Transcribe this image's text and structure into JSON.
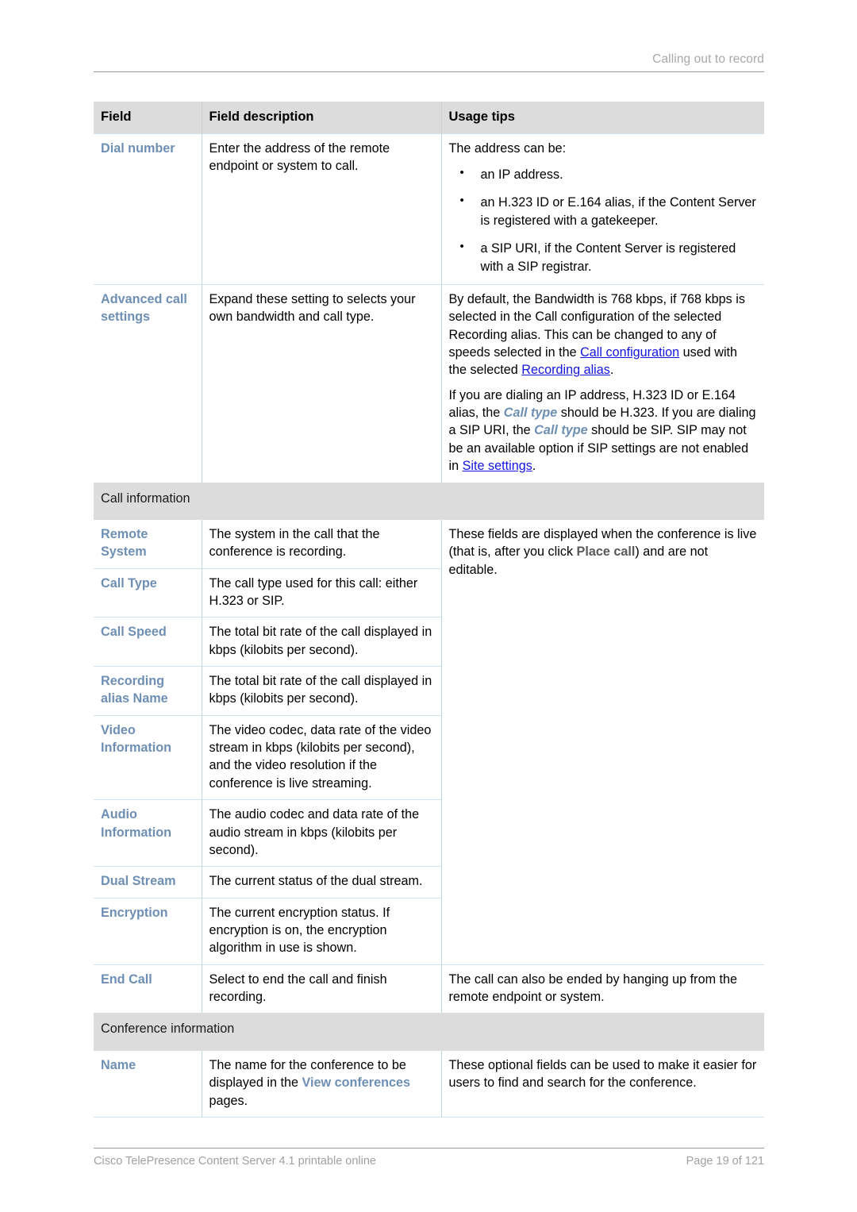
{
  "header": {
    "running_title": "Calling out to record"
  },
  "table": {
    "columns": [
      "Field",
      "Field description",
      "Usage tips"
    ],
    "sections": [
      {
        "band": null,
        "rows": [
          {
            "field": "Dial number",
            "description": "Enter the address of the remote endpoint or system to call.",
            "tips_intro": "The address can be:",
            "tips_bullets": [
              "an IP address.",
              "an H.323 ID or E.164 alias, if the Content Server is registered with a gatekeeper.",
              "a SIP URI, if the Content Server is registered with a SIP registrar."
            ]
          },
          {
            "field": "Advanced call settings",
            "description": "Expand these setting to selects your own bandwidth and call type.",
            "tips_p1_a": "By default, the Bandwidth is 768 kbps, if 768 kbps is selected in the Call configuration of the selected Recording alias. This can be changed to any of speeds selected in the ",
            "tips_p1_link1": "Call configuration",
            "tips_p1_b": " used with the selected ",
            "tips_p1_link2": "Recording alias",
            "tips_p1_c": ".",
            "tips_p2_a": "If you are dialing an IP address, H.323 ID or E.164 alias, the ",
            "tips_p2_ui1": "Call type",
            "tips_p2_b": " should be H.323. If you are dialing a SIP URI, the ",
            "tips_p2_ui2": "Call type",
            "tips_p2_c": " should be SIP. SIP may not be an available option if SIP settings are not enabled in ",
            "tips_p2_link1": "Site settings",
            "tips_p2_d": "."
          }
        ]
      },
      {
        "band": "Call information",
        "rows": [
          {
            "field": "Remote System",
            "description": "The system in the call that the conference is recording."
          },
          {
            "field": "Call Type",
            "description": "The call type used for this call: either H.323 or SIP."
          },
          {
            "field": "Call Speed",
            "description": "The total bit rate of the call displayed in kbps (kilobits per second)."
          },
          {
            "field": "Recording alias Name",
            "description": "The total bit rate of the call displayed in kbps (kilobits per second)."
          },
          {
            "field": "Video Information",
            "description": "The video codec, data rate of the video stream in kbps (kilobits per second), and the video resolution if the conference is live streaming."
          },
          {
            "field": "Audio Information",
            "description": "The audio codec and data rate of the audio stream in kbps (kilobits per second)."
          },
          {
            "field": "Dual Stream",
            "description": "The current status of the dual stream."
          },
          {
            "field": "Encryption",
            "description": "The current encryption status. If encryption is on, the encryption algorithm in use is shown."
          }
        ],
        "merged_tips_a": "These fields are displayed when the conference is live (that is, after you click ",
        "merged_tips_ui": "Place call",
        "merged_tips_b": ") and are not editable."
      },
      {
        "band": null,
        "rows": [
          {
            "field": "End Call",
            "description": "Select to end the call and finish recording.",
            "tips": "The call can also be ended by hanging up from the remote endpoint or system."
          }
        ]
      },
      {
        "band": "Conference information",
        "rows": [
          {
            "field": "Name",
            "description_a": "The name for the conference to be displayed in the ",
            "description_ui": "View conferences",
            "description_b": " pages.",
            "tips": "These optional fields can be used to make it easier for users to find and search for the conference."
          }
        ]
      }
    ]
  },
  "footer": {
    "left": "Cisco TelePresence Content Server 4.1 printable online",
    "right": "Page 19 of 121"
  }
}
